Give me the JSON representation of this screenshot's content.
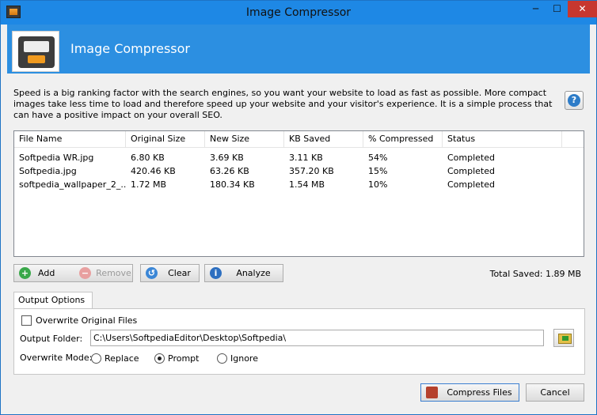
{
  "window": {
    "title": "Image Compressor"
  },
  "titlebar_buttons": {
    "minimize": "─",
    "maximize": "☐",
    "close": "✕"
  },
  "banner": {
    "title": "Image Compressor",
    "logo_icon": "image-compressor-logo-icon"
  },
  "description": "Speed is a big ranking factor with the search engines, so you want your website to load as fast as possible. More compact images take less time to load and therefore speed up your website and your visitor's experience. It is a simple process that can have a positive impact on your overall SEO.",
  "help_button": {
    "glyph": "?"
  },
  "list": {
    "columns": [
      "File Name",
      "Original Size",
      "New Size",
      "KB Saved",
      "% Compressed",
      "Status"
    ],
    "rows": [
      [
        "Softpedia WR.jpg",
        "6.80 KB",
        "3.69 KB",
        "3.11 KB",
        "54%",
        "Completed"
      ],
      [
        "Softpedia.jpg",
        "420.46 KB",
        "63.26 KB",
        "357.20 KB",
        "15%",
        "Completed"
      ],
      [
        "softpedia_wallpaper_2_...",
        "1.72 MB",
        "180.34 KB",
        "1.54 MB",
        "10%",
        "Completed"
      ]
    ]
  },
  "actions": {
    "add": "Add",
    "remove": "Remove",
    "clear": "Clear",
    "analyze": "Analyze"
  },
  "total_saved": "Total Saved: 1.89 MB",
  "output_options": {
    "tab_label": "Output Options",
    "overwrite_original_label": "Overwrite Original Files",
    "overwrite_original_checked": false,
    "output_folder_label": "Output Folder:",
    "output_folder_value": "C:\\Users\\SoftpediaEditor\\Desktop\\Softpedia\\",
    "overwrite_mode_label": "Overwrite Mode:",
    "modes": [
      "Replace",
      "Prompt",
      "Ignore"
    ],
    "selected_mode": "Prompt"
  },
  "footer": {
    "compress": "Compress Files",
    "cancel": "Cancel"
  },
  "colors": {
    "titlebar": "#1e88e5",
    "banner": "#2c8fe1",
    "close": "#c7372f"
  }
}
